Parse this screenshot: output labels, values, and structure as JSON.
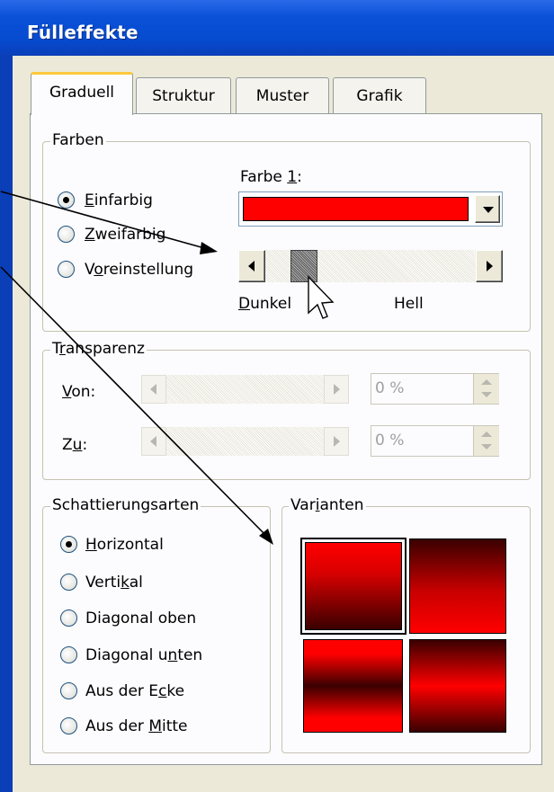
{
  "window": {
    "title": "Fülleffekte"
  },
  "tabs": [
    {
      "label": "Graduell",
      "active": true
    },
    {
      "label": "Struktur",
      "active": false
    },
    {
      "label": "Muster",
      "active": false
    },
    {
      "label": "Grafik",
      "active": false
    }
  ],
  "farben": {
    "legend": "Farben",
    "options": [
      {
        "pre": "",
        "u": "E",
        "post": "infarbig",
        "selected": true
      },
      {
        "pre": "",
        "u": "Z",
        "post": "weifarbig",
        "selected": false
      },
      {
        "pre": "V",
        "u": "o",
        "post": "reinstellung",
        "selected": false
      }
    ],
    "color1_label_pre": "Farbe ",
    "color1_label_u": "1",
    "color1_label_post": ":",
    "color1_value": "#ff0000",
    "slider_min_label_u": "D",
    "slider_min_label_post": "unkel",
    "slider_max_label": "Hell"
  },
  "transparenz": {
    "legend_pre": "T",
    "legend_u": "r",
    "legend_post": "ansparenz",
    "from_label_u": "V",
    "from_label_post": "on:",
    "from_value": "0 %",
    "to_label_pre": "Z",
    "to_label_u": "u",
    "to_label_post": ":",
    "to_value": "0 %"
  },
  "schattierung": {
    "legend": "Schattierungsarten",
    "options": [
      {
        "pre": "",
        "u": "H",
        "post": "orizontal",
        "selected": true
      },
      {
        "pre": "Verti",
        "u": "k",
        "post": "al",
        "selected": false
      },
      {
        "pre": "Diagonal oben",
        "u": "",
        "post": "",
        "selected": false
      },
      {
        "pre": "Diagonal u",
        "u": "n",
        "post": "ten",
        "selected": false
      },
      {
        "pre": "Aus der E",
        "u": "c",
        "post": "ke",
        "selected": false
      },
      {
        "pre": "Aus der ",
        "u": "M",
        "post": "itte",
        "selected": false
      }
    ]
  },
  "varianten": {
    "legend_pre": "Var",
    "legend_u": "i",
    "legend_post": "anten"
  },
  "colors": {
    "titlebar": "#0a51d8",
    "dialog_bg": "#ece9d8",
    "accent_red": "#ff0000",
    "dark_red": "#3a0000"
  }
}
